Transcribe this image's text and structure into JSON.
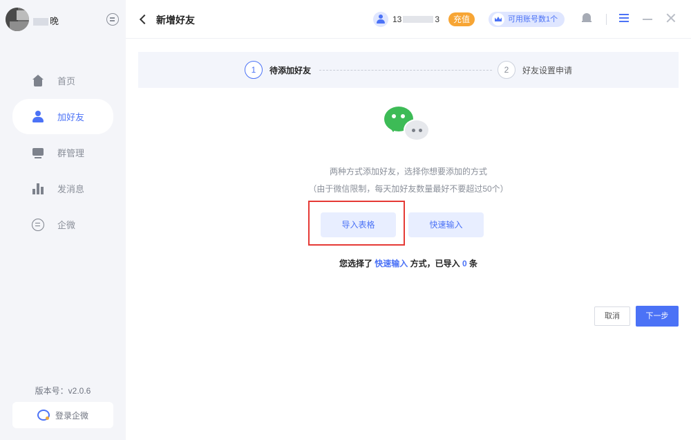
{
  "sidebar": {
    "username_suffix": "晚",
    "nav": [
      {
        "label": "首页",
        "icon": "home-icon",
        "active": false
      },
      {
        "label": "加好友",
        "icon": "user-icon",
        "active": true
      },
      {
        "label": "群管理",
        "icon": "group-icon",
        "active": false
      },
      {
        "label": "发消息",
        "icon": "bar-chart-icon",
        "active": false
      },
      {
        "label": "企微",
        "icon": "chat-icon",
        "active": false
      }
    ],
    "version": "版本号：v2.0.6",
    "login_label": "登录企微"
  },
  "header": {
    "title": "新增好友",
    "phone_prefix": "13",
    "phone_suffix": "3",
    "recharge_label": "充值",
    "accounts_label": "可用账号数1个"
  },
  "steps": [
    {
      "num": "1",
      "label": "待添加好友",
      "active": true
    },
    {
      "num": "2",
      "label": "好友设置申请",
      "active": false
    }
  ],
  "main": {
    "desc_line1": "两种方式添加好友，选择你想要添加的方式",
    "desc_line2": "（由于微信限制，每天加好友数量最好不要超过50个）",
    "import_label": "导入表格",
    "quick_label": "快速输入",
    "summary_pre": "您选择了",
    "summary_method": "快速输入",
    "summary_mid": "方式，已导入",
    "summary_count": "0",
    "summary_post": "条"
  },
  "footer": {
    "cancel_label": "取消",
    "next_label": "下一步"
  },
  "colors": {
    "accent": "#4b72f6",
    "recharge": "#f7a534",
    "wechat_green": "#3dbb56",
    "highlight_red": "#e53935"
  }
}
